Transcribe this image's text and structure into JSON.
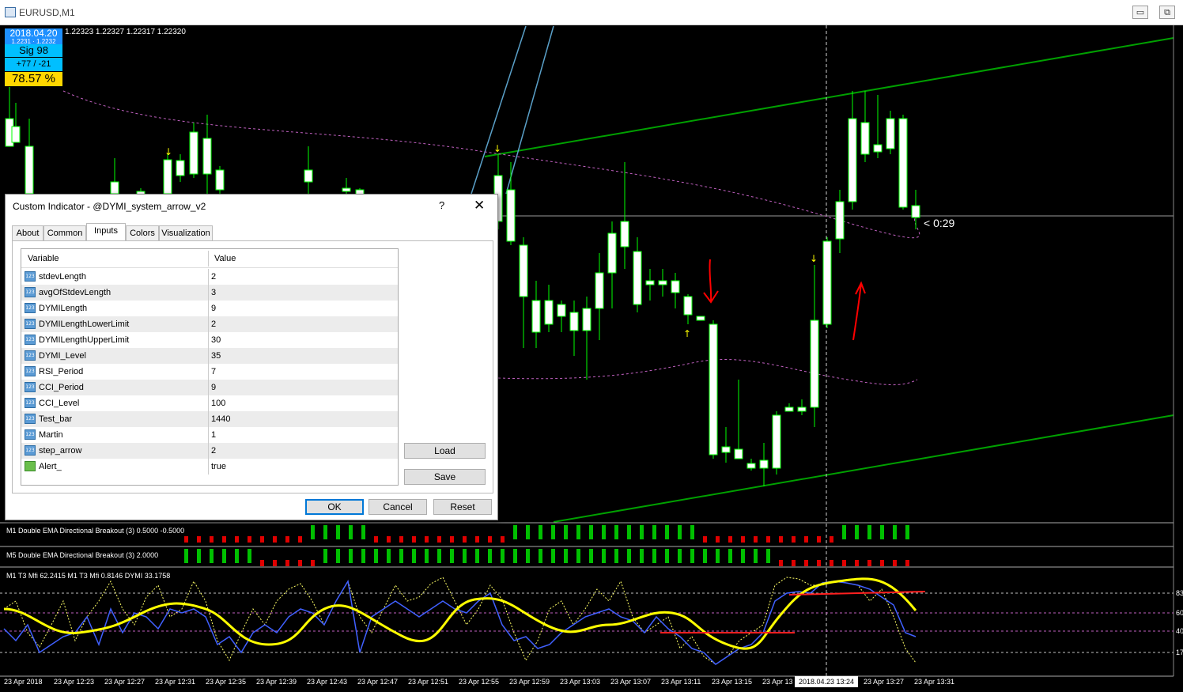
{
  "window": {
    "title": "EURUSD,M1",
    "ohlc_line": "1.22323 1.22327 1.22317 1.22320",
    "buttons": {
      "minimize": "▭",
      "restore": "⧉"
    }
  },
  "info_panel": {
    "date": "2018.04.20",
    "prices": "1.2231 · 1.2232",
    "sig": "Sig  98",
    "score": "+77 / -21",
    "percent": "78.57 %"
  },
  "countdown": "< 0:29",
  "indicator_labels": {
    "m1_breakout": "M1 Double EMA Directional Breakout (3) 0.5000 -0.5000",
    "m5_breakout": "M5 Double EMA Directional Breakout (3) 2.0000",
    "oscillator": "M1  T3 Mfi  62.2415   M1  T3 Mfi  0.8146   DYMI 33.1758"
  },
  "oscillator_levels": [
    "83",
    "60",
    "40",
    "17"
  ],
  "time_axis": [
    "23 Apr 2018",
    "23 Apr 12:23",
    "23 Apr 12:27",
    "23 Apr 12:31",
    "23 Apr 12:35",
    "23 Apr 12:39",
    "23 Apr 12:43",
    "23 Apr 12:47",
    "23 Apr 12:51",
    "23 Apr 12:55",
    "23 Apr 12:59",
    "23 Apr 13:03",
    "23 Apr 13:07",
    "23 Apr 13:11",
    "23 Apr 13:15",
    "23 Apr 13",
    "23 Apr 13:27",
    "23 Apr 13:31"
  ],
  "time_highlight": "2018.04.23 13:24",
  "dialog": {
    "title": "Custom Indicator - @DYMI_system_arrow_v2",
    "help": "?",
    "close": "✕",
    "tabs": [
      "About",
      "Common",
      "Inputs",
      "Colors",
      "Visualization"
    ],
    "active_tab": "Inputs",
    "table_headers": {
      "variable": "Variable",
      "value": "Value"
    },
    "params": [
      {
        "name": "stdevLength",
        "value": "2",
        "type": "num"
      },
      {
        "name": "avgOfStdevLength",
        "value": "3",
        "type": "num"
      },
      {
        "name": "DYMILength",
        "value": "9",
        "type": "num"
      },
      {
        "name": "DYMILengthLowerLimit",
        "value": "2",
        "type": "num"
      },
      {
        "name": "DYMILengthUpperLimit",
        "value": "30",
        "type": "num"
      },
      {
        "name": "DYMI_Level",
        "value": "35",
        "type": "num"
      },
      {
        "name": "RSI_Period",
        "value": "7",
        "type": "num"
      },
      {
        "name": "CCI_Period",
        "value": "9",
        "type": "num"
      },
      {
        "name": "CCI_Level",
        "value": "100",
        "type": "num"
      },
      {
        "name": "Test_bar",
        "value": "1440",
        "type": "num"
      },
      {
        "name": "Martin",
        "value": "1",
        "type": "num"
      },
      {
        "name": "step_arrow",
        "value": "2",
        "type": "num"
      },
      {
        "name": "Alert_",
        "value": "true",
        "type": "bool"
      }
    ],
    "param_icon_text": "123",
    "buttons": {
      "load": "Load",
      "save": "Save",
      "ok": "OK",
      "cancel": "Cancel",
      "reset": "Reset"
    }
  },
  "colors": {
    "bull_candle": "#ffffff",
    "candle_wick": "#00ff00",
    "channel": "#00a000",
    "ma_dotted": "#c060c0",
    "signal_arrow": "#ffff00",
    "annotation": "#ff0000",
    "histo_up": "#00c000",
    "histo_down": "#e00000",
    "osc_yellow": "#ffff00",
    "osc_blue": "#4060ff",
    "osc_red": "#ff2020"
  }
}
